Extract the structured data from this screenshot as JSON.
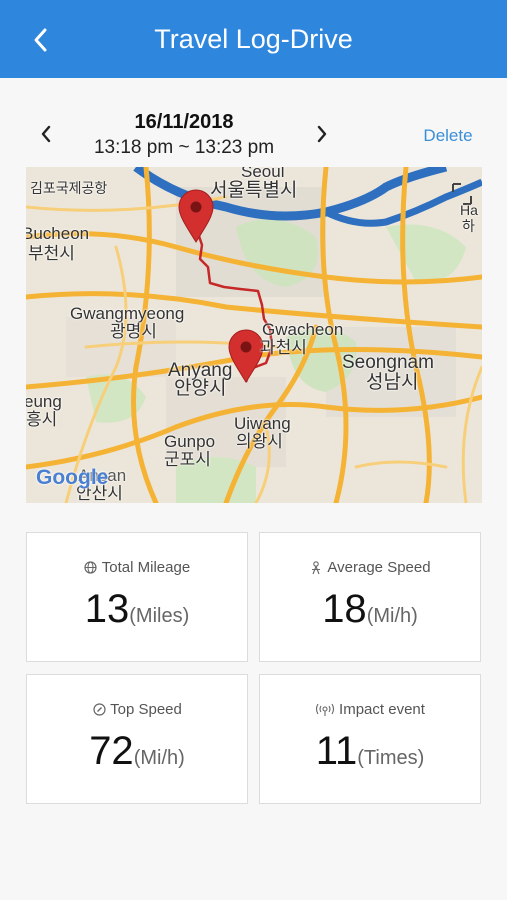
{
  "header": {
    "title": "Travel Log-Drive"
  },
  "trip": {
    "date": "16/11/2018",
    "time_range": "13:18 pm ~ 13:23 pm",
    "delete_label": "Delete"
  },
  "map": {
    "labels": {
      "seoul_en": "Seoul",
      "seoul_ko": "서울특별시",
      "gimpo_airport": "김포국제공항",
      "bucheon_en": "Bucheon",
      "bucheon_ko": "부천시",
      "han_en": "Ha",
      "han_ko": "하",
      "gwangmyeong_en": "Gwangmyeong",
      "gwangmyeong_ko": "광명시",
      "gwacheon_en": "Gwacheon",
      "gwacheon_ko": "과천시",
      "seongnam_en": "Seongnam",
      "seongnam_ko": "성남시",
      "anyang_en": "Anyang",
      "anyang_ko": "안양시",
      "siheung_en": "eung",
      "siheung_ko": "흥시",
      "uiwang_en": "Uiwang",
      "uiwang_ko": "의왕시",
      "gunpo_en": "Gunpo",
      "gunpo_ko": "군포시",
      "ansan_en": "Ansan",
      "ansan_ko": "안산시",
      "google": "Google"
    }
  },
  "stats": {
    "total_mileage": {
      "label": "Total Mileage",
      "value": "13",
      "unit": "(Miles)",
      "icon": "globe-icon"
    },
    "average_speed": {
      "label": "Average Speed",
      "value": "18",
      "unit": "(Mi/h)",
      "icon": "person-icon"
    },
    "top_speed": {
      "label": "Top Speed",
      "value": "72",
      "unit": "(Mi/h)",
      "icon": "compass-icon"
    },
    "impact_event": {
      "label": "Impact event",
      "value": "11",
      "unit": "(Times)",
      "icon": "broadcast-icon"
    }
  },
  "colors": {
    "app_bar": "#2f86dd",
    "delete_link": "#3a8fd8",
    "route": "#c62828",
    "marker": "#d32f2f",
    "road_major": "#f5b335",
    "river": "#2e6fbf"
  }
}
